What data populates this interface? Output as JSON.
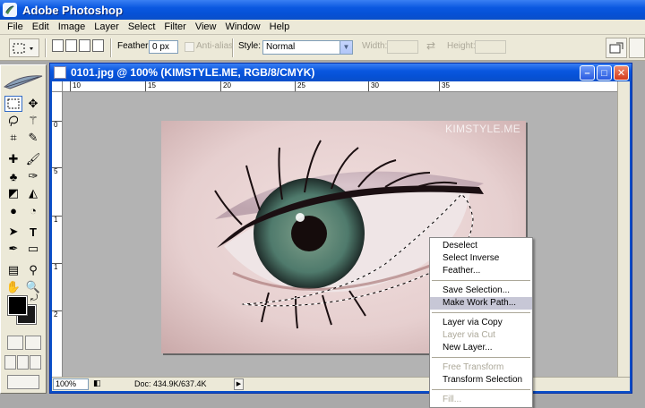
{
  "app": {
    "title": "Adobe Photoshop"
  },
  "menu": [
    "File",
    "Edit",
    "Image",
    "Layer",
    "Select",
    "Filter",
    "View",
    "Window",
    "Help"
  ],
  "options": {
    "feather_label": "Feather:",
    "feather_value": "0 px",
    "antialias_label": "Anti-alias",
    "style_label": "Style:",
    "style_value": "Normal",
    "width_label": "Width:",
    "height_label": "Height:"
  },
  "document": {
    "title": "0101.jpg @ 100% (KIMSTYLE.ME, RGB/8/CMYK)",
    "watermark": "KIMSTYLE.ME",
    "ruler_h": [
      "10",
      "15",
      "20",
      "25",
      "30",
      "35"
    ],
    "ruler_v": [
      "0",
      "5",
      "1",
      "1",
      "2"
    ],
    "zoom": "100%",
    "doc_info": "Doc: 434.9K/637.4K"
  },
  "context_menu": {
    "groups": [
      [
        {
          "label": "Deselect",
          "state": "normal"
        },
        {
          "label": "Select Inverse",
          "state": "normal"
        },
        {
          "label": "Feather...",
          "state": "normal"
        }
      ],
      [
        {
          "label": "Save Selection...",
          "state": "normal"
        },
        {
          "label": "Make Work Path...",
          "state": "highlighted"
        }
      ],
      [
        {
          "label": "Layer via Copy",
          "state": "normal"
        },
        {
          "label": "Layer via Cut",
          "state": "disabled"
        },
        {
          "label": "New Layer...",
          "state": "normal"
        }
      ],
      [
        {
          "label": "Free Transform",
          "state": "disabled"
        },
        {
          "label": "Transform Selection",
          "state": "normal"
        }
      ],
      [
        {
          "label": "Fill...",
          "state": "disabled"
        }
      ]
    ]
  },
  "colors": {
    "titlebar_blue": "#0a58e0",
    "workspace_gray": "#a9a9a9",
    "menu_highlight": "#c7c7d6",
    "foreground_color": "#000000",
    "background_color": "#1a1a1a"
  },
  "tools": [
    "rect-marquee",
    "move",
    "lasso",
    "magic-wand",
    "crop",
    "slice",
    "healing-brush",
    "brush",
    "clone-stamp",
    "history-brush",
    "eraser",
    "paint-bucket",
    "blur",
    "dodge",
    "path-select",
    "type",
    "pen",
    "shape",
    "notes",
    "eyedropper",
    "hand",
    "zoom"
  ]
}
